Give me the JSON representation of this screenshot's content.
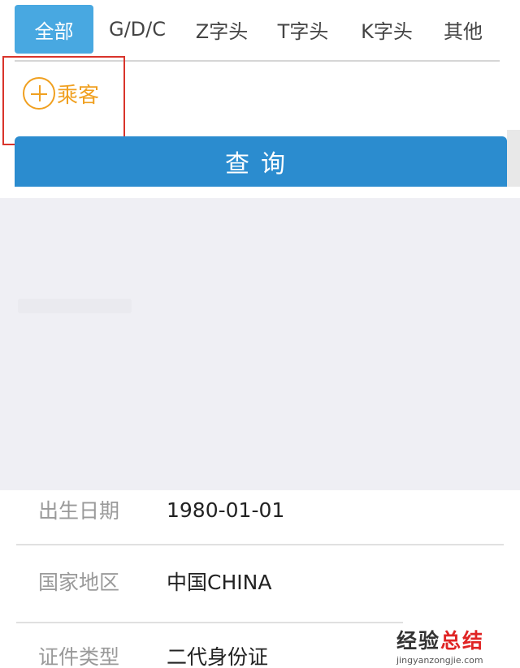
{
  "filter_tabs": [
    {
      "label": "全部",
      "active": true
    },
    {
      "label": "G/D/C",
      "active": false
    },
    {
      "label": "Z字头",
      "active": false
    },
    {
      "label": "T字头",
      "active": false
    },
    {
      "label": "K字头",
      "active": false
    },
    {
      "label": "其他",
      "active": false
    }
  ],
  "add_passenger": {
    "label": "乘客",
    "icon": "plus-circle-icon"
  },
  "query_button": {
    "label": "查询"
  },
  "form": {
    "rows": [
      {
        "label": "出生日期",
        "value": "1980-01-01"
      },
      {
        "label": "国家地区",
        "value": "中国CHINA"
      },
      {
        "label": "证件类型",
        "value": "二代身份证"
      }
    ]
  },
  "watermark": {
    "main_left": "经验",
    "main_right": "总结",
    "sub": "jingyanzongjie.com"
  },
  "colors": {
    "active_tab": "#48a8e1",
    "query_button": "#2b8ccf",
    "add_accent": "#f0a020",
    "highlight_box": "#d9342b",
    "grey_background": "#efeff4"
  }
}
